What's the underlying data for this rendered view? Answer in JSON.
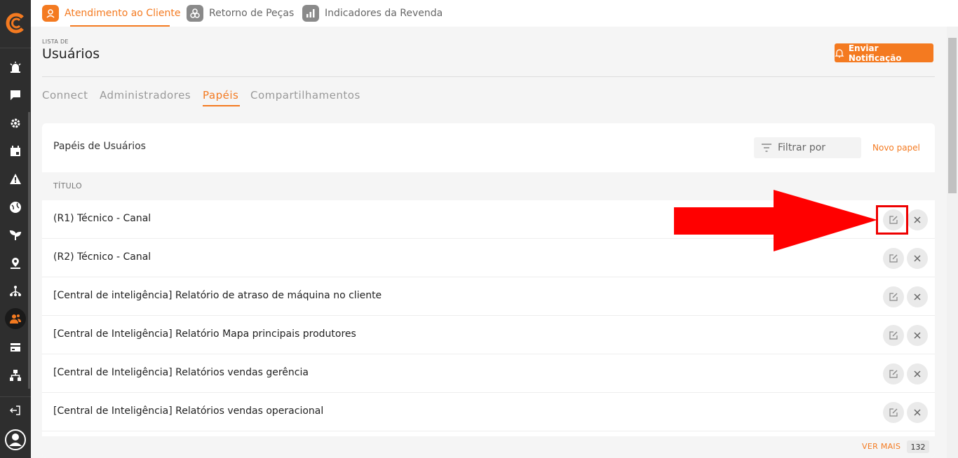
{
  "colors": {
    "accent": "#f47a20",
    "sidebar": "#2e2e2e",
    "highlight": "#e00000"
  },
  "sidebar": {
    "icons": [
      "logo-icon",
      "alarm-icon",
      "chat-icon",
      "settings-icon",
      "calendar-icon",
      "warning-icon",
      "globe-icon",
      "plant-icon",
      "location-icon",
      "hierarchy-icon",
      "users-icon",
      "card-icon",
      "org-chart-icon",
      "logout-icon",
      "profile-icon"
    ]
  },
  "top_tabs": [
    {
      "label": "Atendimento ao Cliente",
      "active": true
    },
    {
      "label": "Retorno de Peças",
      "active": false
    },
    {
      "label": "Indicadores da Revenda",
      "active": false
    }
  ],
  "header": {
    "eyebrow": "LISTA DE",
    "title": "Usuários",
    "notify_button": "Enviar Notificação"
  },
  "sub_tabs": [
    {
      "label": "Connect",
      "active": false
    },
    {
      "label": "Administradores",
      "active": false
    },
    {
      "label": "Papéis",
      "active": true
    },
    {
      "label": "Compartilhamentos",
      "active": false
    }
  ],
  "card": {
    "title": "Papéis de Usuários",
    "filter_placeholder": "Filtrar por",
    "new_button": "Novo papel",
    "column_header": "TÍTULO",
    "rows": [
      "(R1) Técnico - Canal",
      "(R2) Técnico - Canal",
      "[Central de inteligência] Relatório de atraso de máquina no cliente",
      "[Central de Inteligência] Relatório Mapa principais produtores",
      "[Central de Inteligência] Relatórios vendas gerência",
      "[Central de Inteligência] Relatórios vendas operacional"
    ],
    "see_more": "VER MAIS",
    "total_count": "132"
  }
}
